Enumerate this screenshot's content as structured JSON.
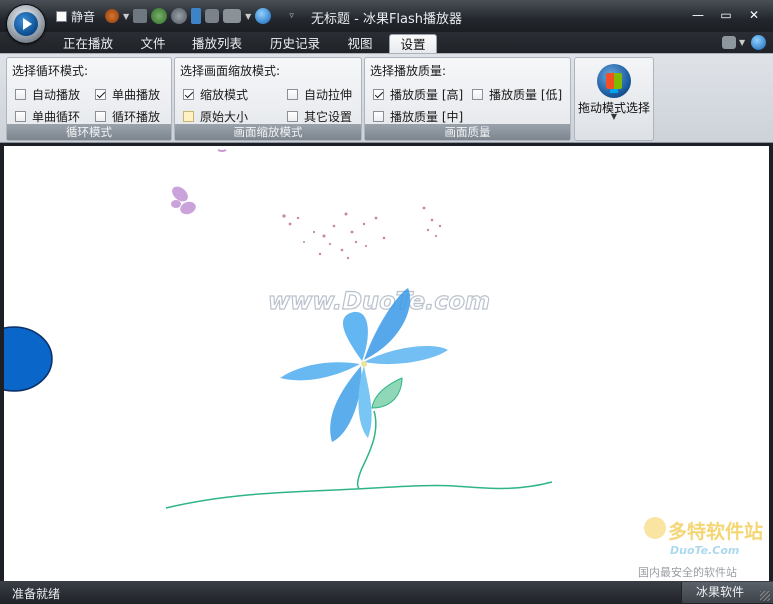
{
  "app": {
    "window_title": "无标题 - 冰果Flash播放器"
  },
  "quick_access": {
    "mute_label": "静音",
    "mute_checked": false
  },
  "tabs": [
    {
      "label": "正在播放",
      "active": false
    },
    {
      "label": "文件",
      "active": false
    },
    {
      "label": "播放列表",
      "active": false
    },
    {
      "label": "历史记录",
      "active": false
    },
    {
      "label": "视图",
      "active": false
    },
    {
      "label": "设置",
      "active": true
    }
  ],
  "ribbon": {
    "loop_group": {
      "heading": "选择循环模式:",
      "footer": "循环模式",
      "options": [
        {
          "label": "自动播放",
          "checked": false
        },
        {
          "label": "单曲播放",
          "checked": true
        },
        {
          "label": "单曲循环",
          "checked": false
        },
        {
          "label": "循环播放",
          "checked": false
        }
      ]
    },
    "zoom_group": {
      "heading": "选择画面缩放模式:",
      "footer": "画面缩放模式",
      "options": [
        {
          "label": "缩放模式",
          "checked": true
        },
        {
          "label": "自动拉伸",
          "checked": false
        },
        {
          "label": "原始大小",
          "checked": false
        },
        {
          "label": "其它设置",
          "checked": false
        }
      ]
    },
    "quality_group": {
      "heading": "选择播放质量:",
      "footer": "画面质量",
      "options": [
        {
          "label": "播放质量 [高]",
          "checked": true
        },
        {
          "label": "播放质量 [低]",
          "checked": false
        },
        {
          "label": "播放质量 [中]",
          "checked": false
        }
      ]
    },
    "drag_mode_button": {
      "label": "拖动模式选择"
    }
  },
  "canvas": {
    "watermark": "www.DuoTe.com",
    "corner_logo": {
      "brand": "多特软件站",
      "domain": "DuoTe.Com",
      "slogan": "国内最安全的软件站"
    }
  },
  "status": {
    "left": "准备就绪",
    "right": "冰果软件"
  },
  "colors": {
    "accent_blue": "#0a66c8",
    "flower_blue": "#3aa7ee",
    "stem_green": "#2fb585"
  }
}
